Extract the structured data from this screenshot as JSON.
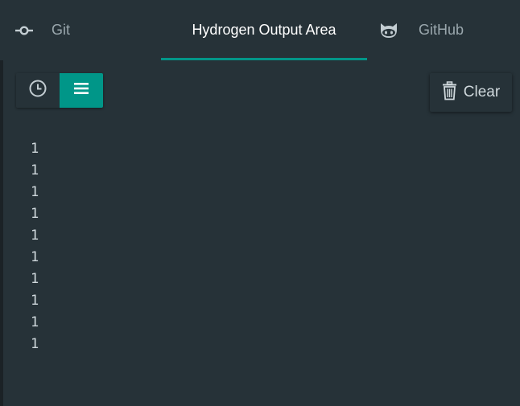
{
  "tabs": [
    {
      "label": "Git",
      "icon": "git-commit-icon"
    },
    {
      "label": "Hydrogen Output Area",
      "active": true
    },
    {
      "label": "GitHub",
      "icon": "octocat-icon"
    }
  ],
  "toolbar": {
    "history_icon": "clock-icon",
    "list_icon": "list-icon",
    "clear_label": "Clear",
    "clear_icon": "trash-icon"
  },
  "output": {
    "lines": [
      "1",
      "1",
      "1",
      "1",
      "1",
      "1",
      "1",
      "1",
      "1",
      "1"
    ]
  },
  "colors": {
    "background": "#263238",
    "accent": "#009688",
    "text": "#cfd8dc",
    "inactive_tab": "#9aa7ad"
  }
}
